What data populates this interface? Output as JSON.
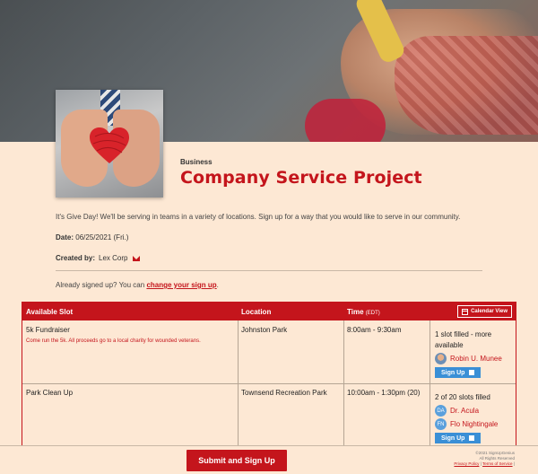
{
  "event": {
    "category": "Business",
    "title": "Company Service Project",
    "description": "It's Give Day! We'll be serving in teams in a variety of locations. Sign up for a way that you would like to serve in our community.",
    "date_label": "Date:",
    "date_value": "06/25/2021 (Fri.)",
    "created_label": "Created by:",
    "created_value": "Lex Corp"
  },
  "signed_up": {
    "prefix": "Already signed up? You can",
    "link": "change your sign up",
    "suffix": "."
  },
  "table": {
    "headers": {
      "slot": "Available Slot",
      "location": "Location",
      "time": "Time",
      "timezone": "(EDT)",
      "calendar": "Calendar View"
    },
    "rows": [
      {
        "slot": "5k Fundraiser",
        "note": "Come run the 5k. All proceeds go to a local charity for wounded veterans.",
        "location": "Johnston Park",
        "time": "8:00am - 9:30am",
        "status": "1 slot filled - more available",
        "people": [
          {
            "name": "Robin U. Munee",
            "initials": ""
          }
        ],
        "button": "Sign Up"
      },
      {
        "slot": "Park Clean Up",
        "note": "",
        "location": "Townsend Recreation Park",
        "time": "10:00am - 1:30pm (20)",
        "status": "2 of 20 slots filled",
        "people": [
          {
            "name": "Dr. Acula",
            "initials": "DA"
          },
          {
            "name": "Flo Nightingale",
            "initials": "FN"
          }
        ],
        "button": "Sign Up"
      }
    ]
  },
  "footer": {
    "submit": "Submit and Sign Up",
    "copyright": "©2021 SignUpGenius",
    "rights": "All Rights Reserved",
    "privacy": "Privacy Policy",
    "separator": "|",
    "terms": "Terms of Service",
    "trailing_separator": "|"
  },
  "colors": {
    "accent": "#c4151c",
    "background": "#fde8d4",
    "button_blue": "#3a8fd6"
  }
}
